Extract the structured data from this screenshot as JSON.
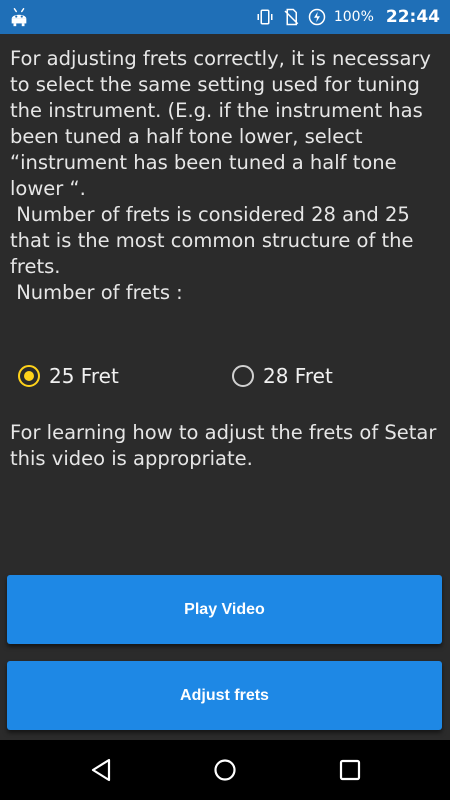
{
  "status_bar": {
    "battery_percent": "100%",
    "time": "22:44",
    "background_color": "#1f6fb7",
    "icons": [
      "android-icon",
      "vibrate-icon",
      "no-sim-icon",
      "battery-saver-icon"
    ]
  },
  "info": {
    "paragraph1": "For adjusting frets correctly, it is necessary to select the same setting used for tuning the instrument. (E.g. if the instrument has been tuned a half tone lower, select “instrument has been tuned a half tone lower “.",
    "paragraph2": " Number of frets is considered 28 and 25 that is the most common structure of the frets.",
    "paragraph3": " Number of frets :"
  },
  "radio_options": [
    {
      "label": "25 Fret",
      "selected": true
    },
    {
      "label": "28 Fret",
      "selected": false
    }
  ],
  "learn_text": "For learning how to adjust the frets of Setar this video is appropriate.",
  "buttons": {
    "play_video": "Play Video",
    "adjust_frets": "Adjust frets",
    "button_color": "#1e88e5"
  },
  "nav_bar": {
    "icons": [
      "back-icon",
      "home-icon",
      "recents-icon"
    ]
  },
  "colors": {
    "background": "#2b2b2b",
    "radio_accent": "#ffd21a",
    "text": "#e6e6e6"
  }
}
